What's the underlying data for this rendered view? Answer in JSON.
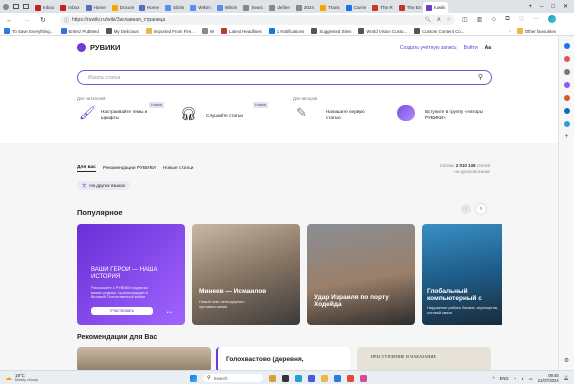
{
  "tabs": [
    {
      "label": "Inbox",
      "color": "#c5221f"
    },
    {
      "label": "Inbox",
      "color": "#c5221f"
    },
    {
      "label": "Home",
      "color": "#5c6bc0"
    },
    {
      "label": "Docum",
      "color": "#f0a800"
    },
    {
      "label": "Home",
      "color": "#5c6bc0"
    },
    {
      "label": "Siblin",
      "color": "#5b8def"
    },
    {
      "label": "Wikim",
      "color": "#5b8def"
    },
    {
      "label": "Wikim",
      "color": "#5b8def"
    },
    {
      "label": "Searc",
      "color": "#888"
    },
    {
      "label": "define",
      "color": "#888"
    },
    {
      "label": "2024",
      "color": "#888"
    },
    {
      "label": "Trans",
      "color": "#f0a800"
    },
    {
      "label": "Carrie",
      "color": "#1a73e8"
    },
    {
      "label": "The R",
      "color": "#c0392b"
    },
    {
      "label": "The En",
      "color": "#c0392b"
    },
    {
      "label": "ruwiki",
      "color": "#6c3bd1"
    }
  ],
  "browser": {
    "url": "https://ruwiki.ru/wiki/Заглавная_страница",
    "new_tab": "+",
    "minimize": "–",
    "maximize": "□",
    "close": "✕"
  },
  "bookmarks": [
    "To Save Everything...",
    "Entrez PubMed",
    "My Delicious",
    "Imported From Fire...",
    "W",
    "Latest Headlines",
    "1 Notifications",
    "Suggested Sites",
    "World Vision Custo...",
    "Custom Content Co..."
  ],
  "bookmarks_other": "Other favourites",
  "site": {
    "logo": "РУВИКИ",
    "create_account": "Создать учётную запись",
    "login": "Войти",
    "aa": "Aa",
    "search_placeholder": "Искать статьи",
    "readers_label": "Для читателей",
    "authors_label": "Для авторов",
    "new_badge": "Новое",
    "promo1": "Настраивайте темы и шрифты",
    "promo2": "Слушайте статьи",
    "promo3": "Напишите первую статью",
    "promo4": "Вступите в группу «Авторы РУВИКИ»",
    "tab_for_you": "Для вас",
    "tab_recs": "Рекомендации РУВИКИ",
    "tab_new": "Новые статьи",
    "other_langs": "На других языках",
    "stats_line1": "Сейчас",
    "stats_count": "2 010 139",
    "stats_line1b": "статей",
    "stats_line2": "на русском языке",
    "popular": "Популярное",
    "recs_heading": "Рекомендации для Вас",
    "card1_title": "ВАШИ ГЕРОИ — НАША ИСТОРИЯ",
    "card1_text": "Расскажите о РУВИКИ подвигах ваших родных, произошедших в Великой Отечественной войне",
    "card1_btn": "Участвовать",
    "card2_title": "Минеев — Исмаилов",
    "card2_text": "Новый этап легендарного противостояния",
    "card3_title": "Удар Израиля по порту Ходейда",
    "card4_title": "Глобальный компьютерный с",
    "card4_text": "Нарушение работы банков, аэропортов, сотовой связи",
    "rec2_title": "Голохвастово (деревня,",
    "rec3_title": "ПРЕСТУПЛЕНИЕ И НАКАЗАНИЕ"
  },
  "taskbar": {
    "temp": "19°C",
    "weather": "Mostly cloudy",
    "search": "Search",
    "lang": "ENG",
    "time": "09:45",
    "date": "21/07/2024"
  }
}
